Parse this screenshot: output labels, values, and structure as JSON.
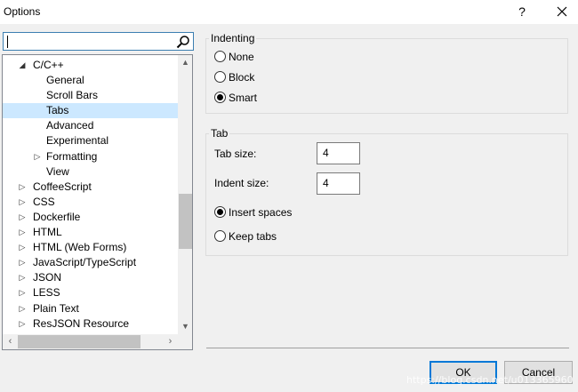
{
  "window": {
    "title": "Options",
    "help_label": "?"
  },
  "search": {
    "value": "",
    "icon": "search-icon"
  },
  "tree": {
    "items": [
      {
        "label": "C/C++",
        "expander": "expanded",
        "level": 0
      },
      {
        "label": "General",
        "level": 1
      },
      {
        "label": "Scroll Bars",
        "level": 1
      },
      {
        "label": "Tabs",
        "level": 1,
        "selected": true
      },
      {
        "label": "Advanced",
        "level": 1
      },
      {
        "label": "Experimental",
        "level": 1
      },
      {
        "label": "Formatting",
        "expander": "collapsed",
        "level": 1
      },
      {
        "label": "View",
        "level": 1
      },
      {
        "label": "CoffeeScript",
        "expander": "collapsed",
        "level": 0
      },
      {
        "label": "CSS",
        "expander": "collapsed",
        "level": 0
      },
      {
        "label": "Dockerfile",
        "expander": "collapsed",
        "level": 0
      },
      {
        "label": "HTML",
        "expander": "collapsed",
        "level": 0
      },
      {
        "label": "HTML (Web Forms)",
        "expander": "collapsed",
        "level": 0
      },
      {
        "label": "JavaScript/TypeScript",
        "expander": "collapsed",
        "level": 0
      },
      {
        "label": "JSON",
        "expander": "collapsed",
        "level": 0
      },
      {
        "label": "LESS",
        "expander": "collapsed",
        "level": 0
      },
      {
        "label": "Plain Text",
        "expander": "collapsed",
        "level": 0
      },
      {
        "label": "ResJSON Resource",
        "expander": "collapsed",
        "level": 0
      }
    ]
  },
  "indenting": {
    "title": "Indenting",
    "options": [
      {
        "label": "None",
        "checked": false
      },
      {
        "label": "Block",
        "checked": false
      },
      {
        "label": "Smart",
        "checked": true
      }
    ]
  },
  "tab": {
    "title": "Tab",
    "tab_size_label": "Tab size:",
    "tab_size_value": "4",
    "indent_size_label": "Indent size:",
    "indent_size_value": "4",
    "options": [
      {
        "label": "Insert spaces",
        "checked": true
      },
      {
        "label": "Keep tabs",
        "checked": false
      }
    ]
  },
  "buttons": {
    "ok": "OK",
    "cancel": "Cancel"
  },
  "watermark": "https://blog.csdn.net/u013365960",
  "colors": {
    "selection": "#cce8ff",
    "accent": "#0078d7"
  }
}
